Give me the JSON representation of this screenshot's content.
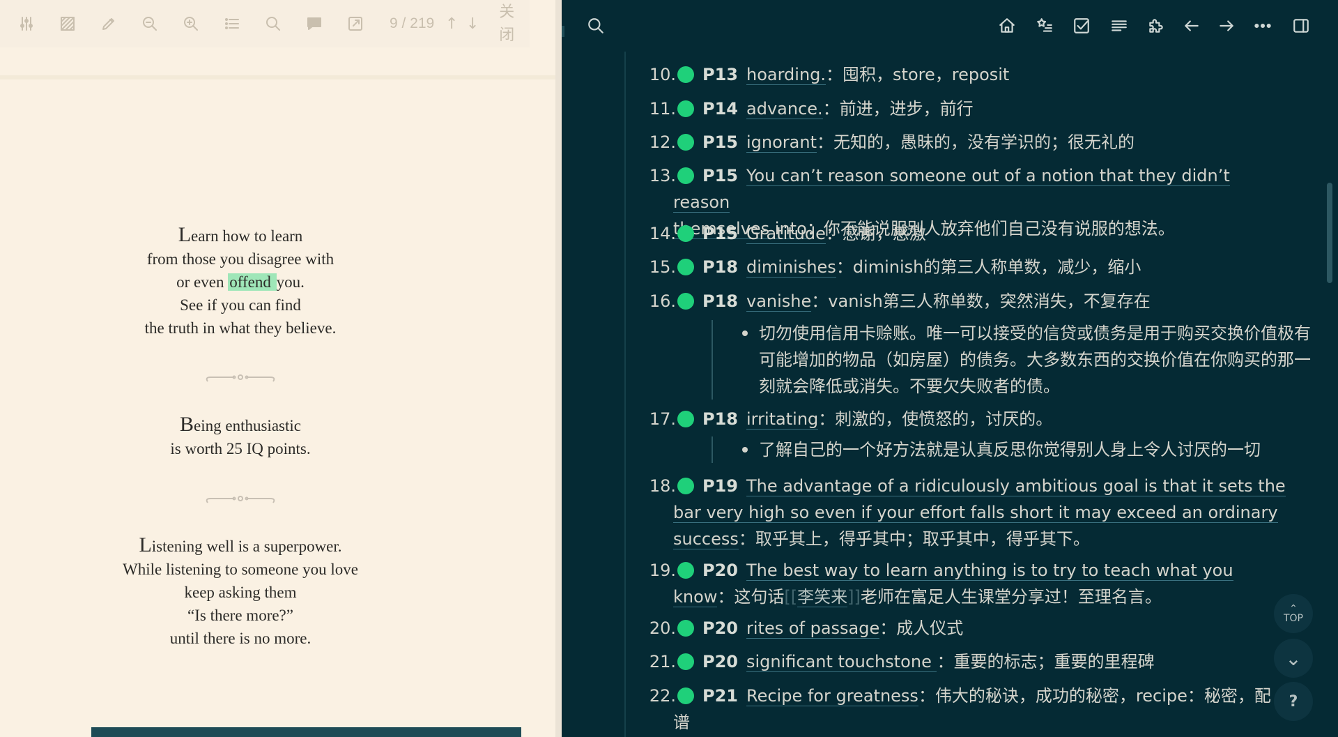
{
  "pdf_toolbar": {
    "icons": [
      "sliders-icon",
      "highlight-area-icon",
      "pencil-icon",
      "zoom-out-icon",
      "zoom-in-icon",
      "outline-icon",
      "search-icon",
      "annotation-icon",
      "export-icon"
    ],
    "page_indicator": "9 / 219",
    "prev_arrow": "↑",
    "next_arrow": "↓",
    "close_label_1": "关",
    "close_label_2": "闭"
  },
  "pdf_page": {
    "q1": {
      "line1_cap": "L",
      "line1_rest": "earn how to learn",
      "line2": "from those you disagree with",
      "line3_pre": "or even ",
      "line3_hl": "offend ",
      "line3_post": "you.",
      "line4": "See if you can find",
      "line5": "the truth in what they believe."
    },
    "q2": {
      "line1_cap": "B",
      "line1_rest": "eing enthusiastic",
      "line2": "is worth 25 IQ points."
    },
    "q3": {
      "line1_cap": "L",
      "line1_rest": "istening well is a superpower.",
      "line2": "While listening to someone you love",
      "line3": "keep asking them",
      "line4": "“Is there more?”",
      "line5": "until there is no more."
    }
  },
  "notes": [
    {
      "num": "10.",
      "tag": "P13",
      "term": "hoarding.",
      "def": "：囤积，store，reposit"
    },
    {
      "num": "11.",
      "tag": "P14",
      "term": "advance.",
      "def": "：前进，进步，前行"
    },
    {
      "num": "12.",
      "tag": "P15",
      "term": "ignorant",
      "def": "：无知的，愚昧的，没有学识的；很无礼的"
    },
    {
      "num": "13.",
      "tag": "P15",
      "term_line1": "You can’t reason someone out of a notion that they didn’t reason",
      "term_line2": "themselves into",
      "def": "：你不能说服别人放弃他们自己没有说服的想法。"
    },
    {
      "num": "14.",
      "tag": "P15",
      "term": "Gratitude",
      "def": "：感谢，感激"
    },
    {
      "num": "15.",
      "tag": "P18",
      "term": "diminishes",
      "def": "：diminish的第三人称单数，减少，缩小"
    },
    {
      "num": "16.",
      "tag": "P18",
      "term": "vanishe",
      "def": "：vanish第三人称单数，突然消失，不复存在",
      "sub_line1": "切勿使用信用卡赊账。唯一可以接受的信贷或债务是用于购买交换价值极有",
      "sub_line2": "可能增加的物品（如房屋）的债务。大多数东西的交换价值在你购买的那一",
      "sub_line3": "刻就会降低或消失。不要欠失败者的债。"
    },
    {
      "num": "17.",
      "tag": "P18",
      "term": "irritating",
      "def": "：刺激的，使愤怒的，讨厌的。",
      "sub_line1": "了解自己的一个好方法就是认真反思你觉得别人身上令人讨厌的一切"
    },
    {
      "num": "18.",
      "tag": "P19",
      "term_line1": "The advantage of a ridiculously ambitious goal is that it sets the",
      "term_line2": "bar very high so even if your effort falls short it may exceed an ordinary",
      "term_line3": "success",
      "def": "：取乎其上，得乎其中；取乎其中，得乎其下。"
    },
    {
      "num": "19.",
      "tag": "P20",
      "term_line1": "The best way to learn anything is to try to teach what you",
      "term_line2": "know",
      "def_pre": "：这句话",
      "wiki_open": "[[",
      "wiki": "李笑来",
      "wiki_close": "]]",
      "def_post": "老师在富足人生课堂分享过！至理名言。"
    },
    {
      "num": "20.",
      "tag": "P20",
      "term": "rites of passage",
      "def": "：成人仪式"
    },
    {
      "num": "21.",
      "tag": "P20",
      "term": "significant touchstone ",
      "def": "：重要的标志；重要的里程碑"
    },
    {
      "num": "22.",
      "tag": "P21",
      "term": "Recipe for greatness",
      "def": "：伟大的秘诀，成功的秘密，recipe：秘密，配",
      "def_line2": "谱"
    }
  ],
  "right_toolbar": {
    "icons": [
      "search-icon",
      "home-icon",
      "star-list-icon",
      "checkbox-icon",
      "list-icon",
      "plugin-icon",
      "back-arrow-icon",
      "forward-arrow-icon",
      "more-icon",
      "sidebar-toggle-icon"
    ]
  },
  "floating": {
    "top_label": "TOP",
    "top_chevron": "⌃",
    "down_chevron": "⌄",
    "help_label": "?"
  },
  "colors": {
    "pdf_bg": "#faf1e3",
    "highlight": "#9fe6b8",
    "notes_bg": "#052a34",
    "dot_green": "#1fd07a",
    "scroll_teal": "#1e4b56"
  }
}
